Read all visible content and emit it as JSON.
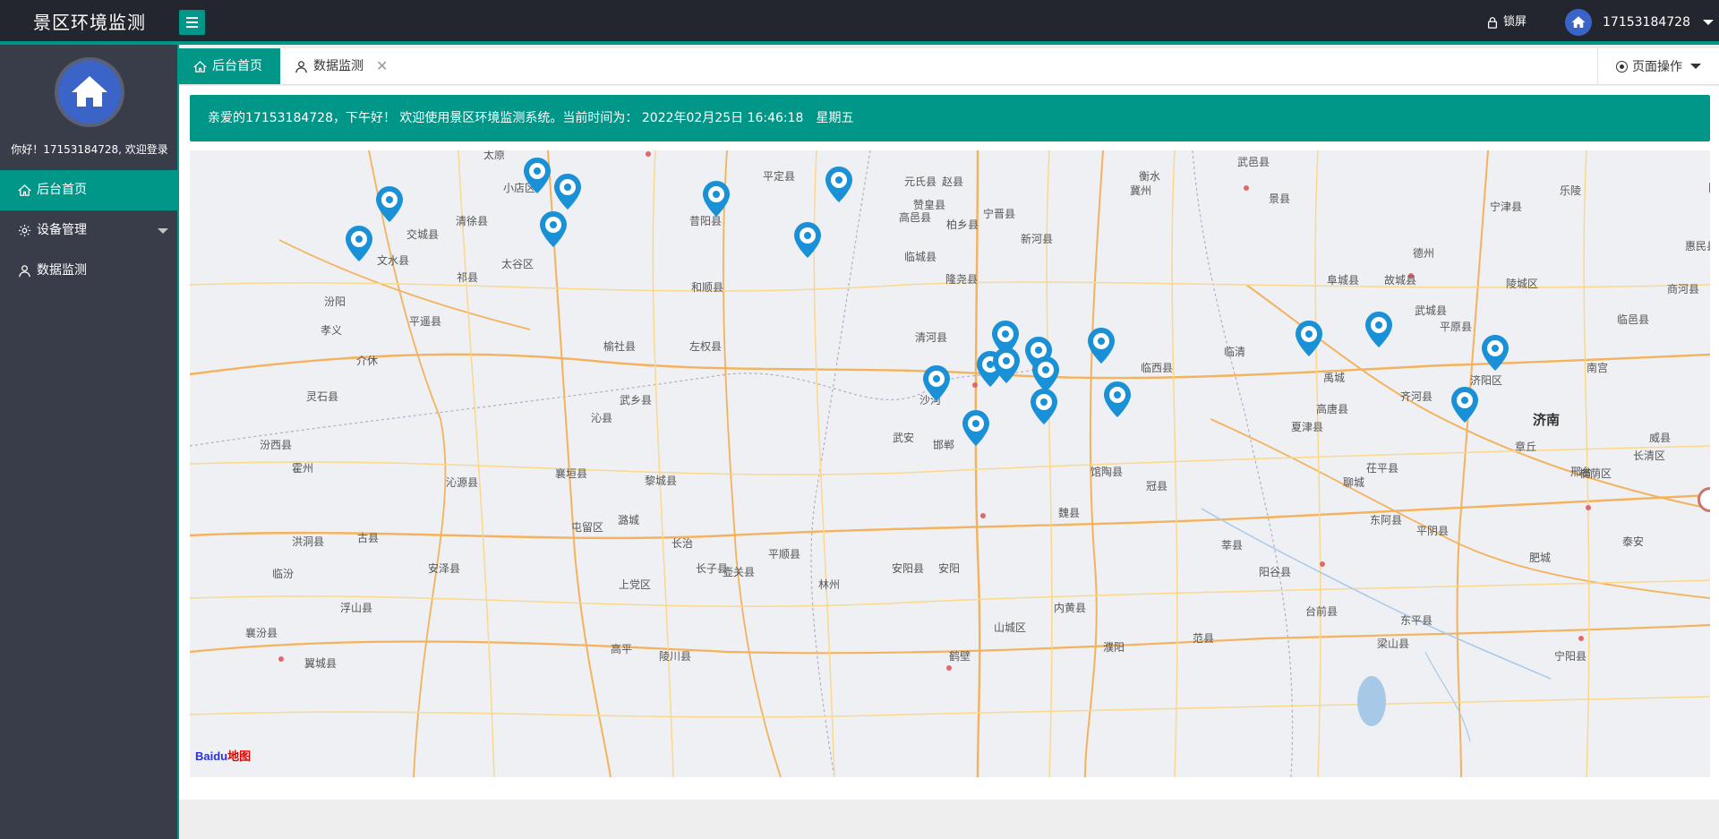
{
  "header": {
    "app_title": "景区环境监测",
    "lock_label": "锁屏",
    "username": "17153184728"
  },
  "sidebar": {
    "welcome": "你好！17153184728, 欢迎登录",
    "items": [
      {
        "label": "后台首页",
        "icon": "home-icon",
        "active": true
      },
      {
        "label": "设备管理",
        "icon": "gear-icon",
        "active": false
      },
      {
        "label": "数据监测",
        "icon": "user-icon",
        "active": false
      }
    ]
  },
  "tabs": [
    {
      "label": "后台首页",
      "icon": "home-icon",
      "active": true
    },
    {
      "label": "数据监测",
      "icon": "user-icon",
      "active": false
    }
  ],
  "page_ops_label": "页面操作",
  "notice": "亲爱的17153184728，下午好！ 欢迎使用景区环境监测系统。当前时间为： 2022年02月25日 16:46:18　星期五",
  "map": {
    "provider_logo": "Baidu",
    "provider_logo_suffix": "地图",
    "places": [
      "太原",
      "小店区",
      "清徐县",
      "交城县",
      "文水县",
      "汾阳",
      "孝义",
      "介休",
      "平遥县",
      "祁县",
      "太谷区",
      "榆社县",
      "左权县",
      "和顺县",
      "昔阳县",
      "平定县",
      "元氏县",
      "赞皇县",
      "赵县",
      "高邑县",
      "柏乡县",
      "宁晋县",
      "临城县",
      "隆尧县",
      "新河县",
      "冀州",
      "衡水",
      "武邑县",
      "景县",
      "阜城县",
      "德州",
      "宁津县",
      "乐陵",
      "阳信县",
      "惠民县",
      "商河县",
      "临邑县",
      "陵城区",
      "平原县",
      "故城县",
      "武城县",
      "南宫",
      "邢台",
      "威县",
      "清河县",
      "临西县",
      "临清",
      "夏津县",
      "高唐县",
      "禹城",
      "齐河县",
      "济阳区",
      "济南",
      "章丘",
      "长清区",
      "槐荫区",
      "灵石县",
      "武乡县",
      "沁县",
      "汾西县",
      "霍州",
      "沁源县",
      "襄垣县",
      "黎城县",
      "武安",
      "邯郸",
      "馆陶县",
      "冠县",
      "聊城",
      "茌平县",
      "东阿县",
      "平阴县",
      "肥城",
      "泰安",
      "魏县",
      "屯留区",
      "潞城",
      "长治",
      "平顺县",
      "壶关县",
      "长子县",
      "上党区",
      "林州",
      "安阳县",
      "安阳",
      "内黄县",
      "莘县",
      "阳谷县",
      "洪洞县",
      "古县",
      "安泽县",
      "临汾",
      "浮山县",
      "襄汾县",
      "翼城县",
      "山城区",
      "鹤壁",
      "濮阳",
      "范县",
      "台前县",
      "东平县",
      "梁山县",
      "宁阳县",
      "高平",
      "陵川县",
      "沙河"
    ]
  },
  "colors": {
    "header_bg": "#23262e",
    "sidebar_bg": "#393d49",
    "accent": "#009688",
    "marker": "#1a90d6"
  }
}
